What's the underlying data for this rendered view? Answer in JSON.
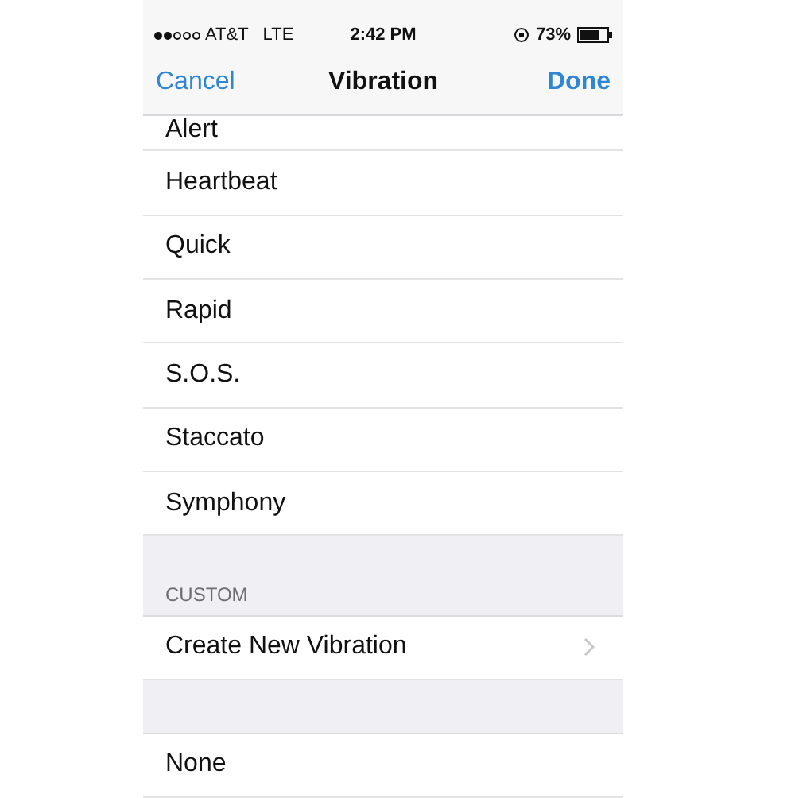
{
  "status_bar": {
    "signal_dots": [
      {
        "filled": true
      },
      {
        "filled": true
      },
      {
        "filled": false
      },
      {
        "filled": false
      },
      {
        "filled": false
      }
    ],
    "carrier": "AT&T",
    "network": "LTE",
    "time": "2:42 PM",
    "battery_percent": "73%"
  },
  "nav_bar": {
    "left_button": "Cancel",
    "title": "Vibration",
    "right_button": "Done"
  },
  "sections": [
    {
      "kind": "list",
      "items": [
        {
          "label": "Alert",
          "cut": true
        },
        {
          "label": "Heartbeat",
          "cut": false
        },
        {
          "label": "Quick",
          "cut": false
        },
        {
          "label": "Rapid",
          "cut": false
        },
        {
          "label": "S.O.S.",
          "cut": false
        },
        {
          "label": "Staccato",
          "cut": false
        },
        {
          "label": "Symphony",
          "cut": false
        }
      ]
    },
    {
      "kind": "header",
      "label": "CUSTOM"
    },
    {
      "kind": "link",
      "label": "Create New Vibration"
    },
    {
      "kind": "spacer"
    },
    {
      "kind": "list",
      "items": [
        {
          "label": "None",
          "cut": false
        }
      ]
    }
  ]
}
